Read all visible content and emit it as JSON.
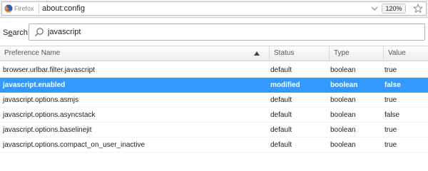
{
  "urlbar": {
    "brand": "Firefox",
    "url": "about:config",
    "zoom": "120%"
  },
  "search": {
    "label_prefix": "S",
    "label_underline": "e",
    "label_suffix": "arch:",
    "value": "javascript"
  },
  "table": {
    "headers": {
      "name": "Preference Name",
      "status": "Status",
      "type": "Type",
      "value": "Value"
    },
    "sort_column": "name",
    "selected_index": 1,
    "rows": [
      {
        "name": "browser.urlbar.filter.javascript",
        "status": "default",
        "type": "boolean",
        "value": "true"
      },
      {
        "name": "javascript.enabled",
        "status": "modified",
        "type": "boolean",
        "value": "false"
      },
      {
        "name": "javascript.options.asmjs",
        "status": "default",
        "type": "boolean",
        "value": "true"
      },
      {
        "name": "javascript.options.asyncstack",
        "status": "default",
        "type": "boolean",
        "value": "false"
      },
      {
        "name": "javascript.options.baselinejit",
        "status": "default",
        "type": "boolean",
        "value": "true"
      },
      {
        "name": "javascript.options.compact_on_user_inactive",
        "status": "default",
        "type": "boolean",
        "value": "true"
      }
    ]
  },
  "colors": {
    "selection": "#3399ff",
    "header_bg": "#ededed"
  }
}
